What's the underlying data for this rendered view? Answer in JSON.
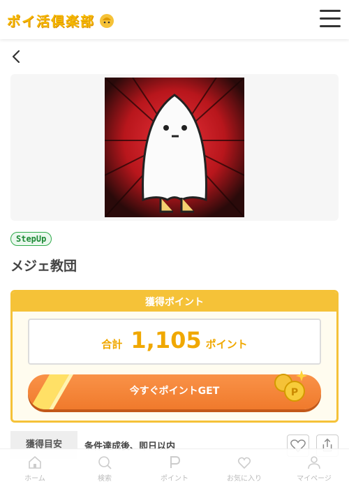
{
  "header": {
    "logo_text": "ポイ活倶楽部",
    "menu_icon": "hamburger-menu-icon"
  },
  "nav": {
    "back_icon": "chevron-left-icon"
  },
  "offer": {
    "badge": "StepUp",
    "title": "メジェ教団"
  },
  "points": {
    "header": "獲得ポイント",
    "total_label": "合計",
    "total_value": "1,105",
    "unit": "ポイント",
    "cta": "今すぐポイントGET"
  },
  "info": {
    "label": "獲得目安",
    "value": "条件達成後、即日以内"
  },
  "bottom_nav": [
    {
      "label": "ホーム",
      "icon": "home-icon"
    },
    {
      "label": "検索",
      "icon": "search-icon"
    },
    {
      "label": "ポイント",
      "icon": "point-icon"
    },
    {
      "label": "お気に入り",
      "icon": "heart-icon"
    },
    {
      "label": "マイページ",
      "icon": "user-icon"
    }
  ],
  "colors": {
    "accent": "#f5c238",
    "cta": "#f07a2c",
    "badge_green": "#2faa4a"
  }
}
